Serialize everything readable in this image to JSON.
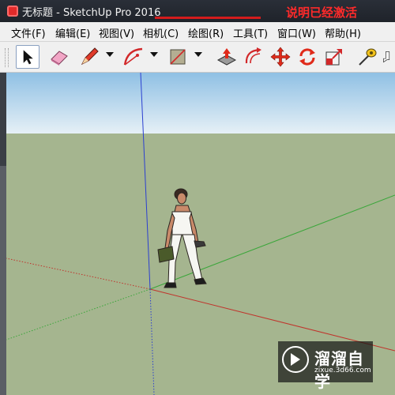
{
  "window": {
    "title": "无标题 - SketchUp Pro 2016",
    "activation_note": "说明已经激活"
  },
  "menu": {
    "items": [
      {
        "label": "文件(F)"
      },
      {
        "label": "编辑(E)"
      },
      {
        "label": "视图(V)"
      },
      {
        "label": "相机(C)"
      },
      {
        "label": "绘图(R)"
      },
      {
        "label": "工具(T)"
      },
      {
        "label": "窗口(W)"
      },
      {
        "label": "帮助(H)"
      }
    ]
  },
  "toolbar": {
    "tools": [
      {
        "icon": "select-arrow-icon",
        "selected": true
      },
      {
        "icon": "eraser-icon"
      },
      {
        "icon": "pencil-line-icon",
        "has_dropdown": true
      },
      {
        "icon": "arc-icon",
        "has_dropdown": true
      },
      {
        "icon": "rectangle-icon",
        "has_dropdown": true
      },
      {
        "icon": "push-pull-icon"
      },
      {
        "icon": "offset-icon"
      },
      {
        "icon": "move-icon"
      },
      {
        "icon": "rotate-icon"
      },
      {
        "icon": "scale-icon"
      },
      {
        "icon": "tape-measure-icon"
      },
      {
        "icon": "text-icon"
      }
    ]
  },
  "colors": {
    "sky_top": "#8fc0e4",
    "sky_bottom": "#e6f0f6",
    "ground": "#a5b58f",
    "axis_red": "#c0342c",
    "axis_green": "#3aa63a",
    "axis_blue": "#2b3fd0",
    "accent_red": "#ff2a2a"
  },
  "watermark": {
    "brand": "溜溜自学",
    "url": "zixue.3d66.com"
  }
}
